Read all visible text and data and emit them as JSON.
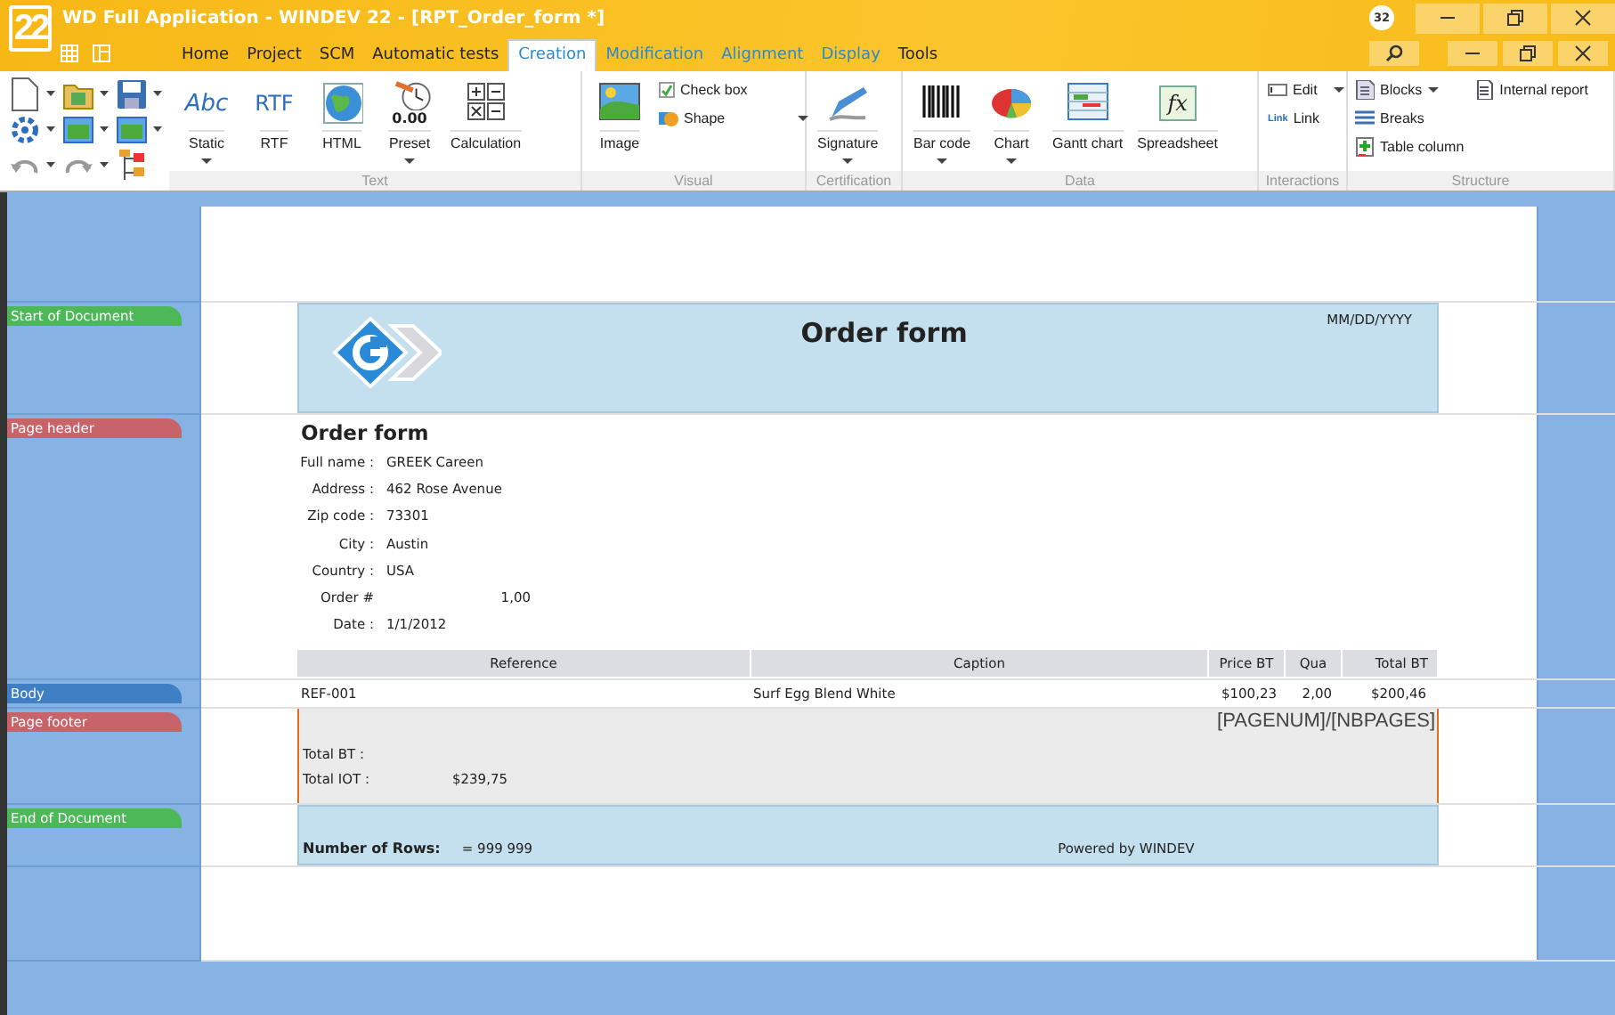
{
  "window": {
    "logo": "22",
    "title": "WD Full Application - WINDEV 22 - [RPT_Order_form *]",
    "badge": "32"
  },
  "tabs": [
    {
      "label": "Home",
      "selected": false
    },
    {
      "label": "Project",
      "selected": false
    },
    {
      "label": "SCM",
      "selected": false
    },
    {
      "label": "Automatic tests",
      "selected": false
    },
    {
      "label": "Creation",
      "selected": true
    },
    {
      "label": "Modification",
      "selected": false
    },
    {
      "label": "Alignment",
      "selected": false
    },
    {
      "label": "Display",
      "selected": false
    },
    {
      "label": "Tools",
      "selected": false
    }
  ],
  "ribbon": {
    "groups": [
      {
        "label": "Text",
        "items": [
          {
            "kind": "large",
            "label": "Static",
            "glyph": "Abc",
            "dropdown": true
          },
          {
            "kind": "large",
            "label": "RTF",
            "glyph": "RTF"
          },
          {
            "kind": "large",
            "label": "HTML"
          },
          {
            "kind": "large",
            "label": "Preset",
            "glyph": "0.00",
            "dropdown": true
          },
          {
            "kind": "large",
            "label": "Calculation"
          }
        ]
      },
      {
        "label": "Visual",
        "items": [
          {
            "kind": "large",
            "label": "Image"
          },
          {
            "kind": "check",
            "label": "Check box",
            "checked": true
          },
          {
            "kind": "small",
            "label": "Shape",
            "dropdown": true
          }
        ]
      },
      {
        "label": "Certification",
        "items": [
          {
            "kind": "large",
            "label": "Signature",
            "dropdown": true
          }
        ]
      },
      {
        "label": "Data",
        "items": [
          {
            "kind": "large",
            "label": "Bar code",
            "dropdown": true
          },
          {
            "kind": "large",
            "label": "Chart",
            "dropdown": true
          },
          {
            "kind": "large",
            "label": "Gantt chart"
          },
          {
            "kind": "large",
            "label": "Spreadsheet",
            "glyph": "fx"
          }
        ]
      },
      {
        "label": "Interactions",
        "items": [
          {
            "kind": "small",
            "label": "Edit",
            "dropdown": true
          },
          {
            "kind": "small",
            "label": "Link",
            "glyph": "Link"
          }
        ]
      },
      {
        "label": "Structure",
        "items": [
          {
            "kind": "small",
            "label": "Blocks",
            "dropdown": true
          },
          {
            "kind": "small",
            "label": "Breaks"
          },
          {
            "kind": "small",
            "label": "Table column"
          },
          {
            "kind": "small",
            "label": "Internal report"
          }
        ]
      }
    ]
  },
  "report": {
    "bands": [
      {
        "kind": "start",
        "label": "Start of Document",
        "color": "#4cb858"
      },
      {
        "kind": "header",
        "label": "Page header",
        "color": "#c8636a"
      },
      {
        "kind": "body",
        "label": "Body",
        "color": "#3f7fc4"
      },
      {
        "kind": "footer",
        "label": "Page footer",
        "color": "#c8636a"
      },
      {
        "kind": "end",
        "label": "End of Document",
        "color": "#4cb858"
      }
    ],
    "start": {
      "title": "Order form",
      "date": "MM/DD/YYYY"
    },
    "header": {
      "title": "Order form",
      "fields": [
        {
          "label": "Full name :",
          "value": "GREEK Careen"
        },
        {
          "label": "Address :",
          "value": "462 Rose Avenue"
        },
        {
          "label": "Zip code :",
          "value": "73301"
        },
        {
          "label": "City :",
          "value": "Austin"
        },
        {
          "label": "Country :",
          "value": "USA"
        },
        {
          "label": "Order #",
          "value": "1,00"
        },
        {
          "label": "Date :",
          "value": "1/1/2012"
        }
      ],
      "columns": [
        "Reference",
        "Caption",
        "Price BT",
        "Qua",
        "Total BT"
      ]
    },
    "body": {
      "cells": [
        "REF-001",
        "Surf Egg Blend White",
        "$100,23",
        "2,00",
        "$200,46"
      ]
    },
    "footer": {
      "pages": "[PAGENUM]/[NBPAGES]",
      "totals": [
        {
          "label": "Total BT :"
        },
        {
          "label": "Total IOT :",
          "value": "$239,75"
        }
      ]
    },
    "end": {
      "label": "Number of Rows:",
      "count": "= 999 999",
      "powered": "Powered by WINDEV"
    }
  }
}
